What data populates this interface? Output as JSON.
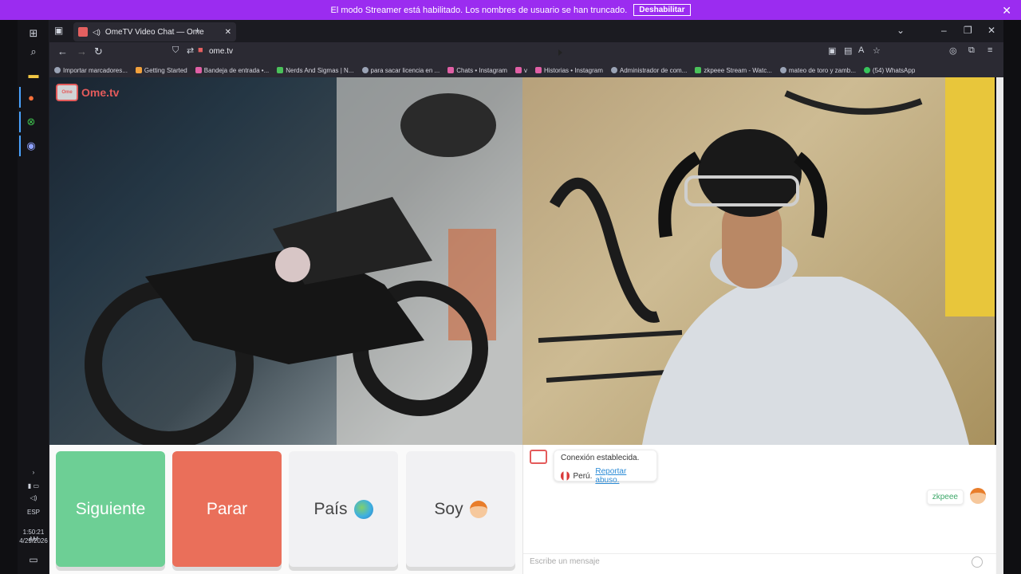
{
  "banner": {
    "text": "El modo Streamer está habilitado. Los nombres de usuario se han truncado.",
    "button": "Deshabilitar",
    "close": "✕"
  },
  "taskbar": {
    "time": "1:50:21 AM",
    "date": "4/29/2026",
    "lang": "ESP"
  },
  "browser": {
    "tab_title": "OmeTV Video Chat — Ome",
    "url": "ome.tv",
    "bookmarks": [
      "Importar marcadores...",
      "Getting Started",
      "Bandeja de entrada •...",
      "Nerds And Sigmas | N...",
      "para sacar licencia en ...",
      "Chats • Instagram",
      "v",
      "Historias • Instagram",
      "Administrador de com...",
      "zkpeee Stream - Watc...",
      "mateo de toro y zamb...",
      "(54) WhatsApp"
    ]
  },
  "ometv": {
    "logo": "Ome.tv",
    "buttons": {
      "next": "Siguiente",
      "stop": "Parar",
      "country": "País",
      "soy": "Soy"
    }
  },
  "chat": {
    "connected": "Conexión establecida.",
    "country": "Perú.",
    "report": "Reportar abuso.",
    "username": "zkpeee",
    "placeholder": "Escribe un mensaje"
  }
}
